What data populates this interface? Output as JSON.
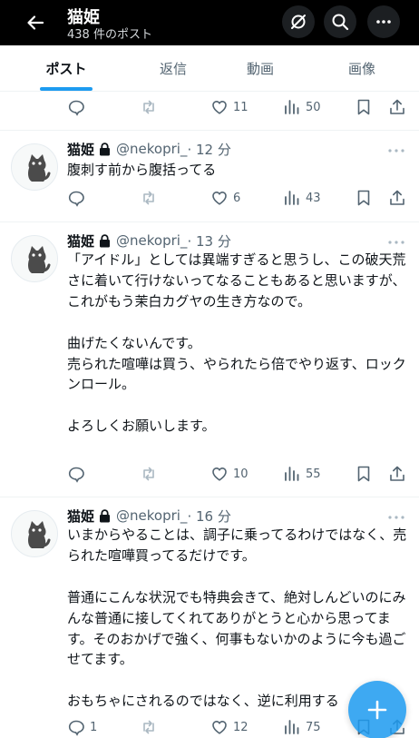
{
  "header": {
    "title": "猫姫",
    "subtitle": "438 件のポスト",
    "icons": [
      "back-arrow-icon",
      "grok-icon",
      "search-icon",
      "more-icon"
    ]
  },
  "tabs": [
    {
      "label": "ポスト",
      "active": true
    },
    {
      "label": "返信",
      "active": false
    },
    {
      "label": "動画",
      "active": false
    },
    {
      "label": "画像",
      "active": false
    }
  ],
  "colors": {
    "accent": "#1d9bf0",
    "header_bg": "#000000",
    "muted": "#536471"
  },
  "posts": [
    {
      "name": "",
      "handle": "",
      "time": "",
      "text": "",
      "replies": "",
      "reposts": "",
      "likes": "11",
      "views": "50"
    },
    {
      "name": "猫姫",
      "handle": "@nekopri_",
      "time": "· 12 分",
      "text": "腹刺す前から腹括ってる",
      "replies": "",
      "reposts": "",
      "likes": "6",
      "views": "43"
    },
    {
      "name": "猫姫",
      "handle": "@nekopri_",
      "time": "· 13 分",
      "text": "「アイドル」としては異端すぎると思うし、この破天荒さに着いて行けないってなることもあると思いますが、これがもう茉白カグヤの生き方なので。\n\n曲げたくないんです。\n売られた喧嘩は買う、やられたら倍でやり返す、ロックンロール。\n\nよろしくお願いします。",
      "replies": "",
      "reposts": "",
      "likes": "10",
      "views": "55"
    },
    {
      "name": "猫姫",
      "handle": "@nekopri_",
      "time": "· 16 分",
      "text": "いまからやることは、調子に乗ってるわけではなく、売られた喧嘩買ってるだけです。\n\n普通にこんな状況でも特典会きて、絶対しんどいのにみんな普通に接してくれてありがとうと心から思ってます。そのおかげで強く、何事もないかのように今も過ごせてます。\n\nおもちゃにされるのではなく、逆に利用する",
      "replies": "1",
      "reposts": "",
      "likes": "12",
      "views": "75"
    }
  ]
}
